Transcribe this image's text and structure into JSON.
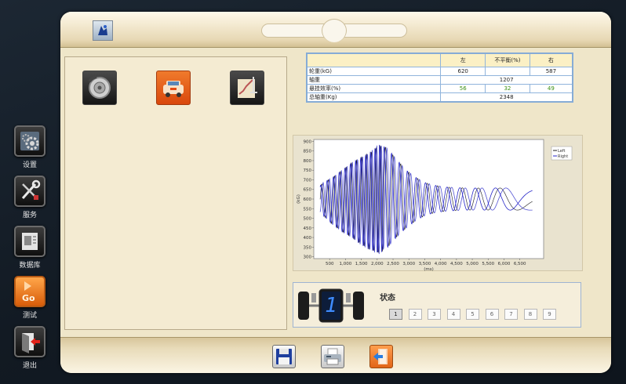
{
  "nav": [
    {
      "key": "settings",
      "label": "设置",
      "icon": "gear-icon"
    },
    {
      "key": "service",
      "label": "服务",
      "icon": "wrench-screwdriver-icon"
    },
    {
      "key": "database",
      "label": "数据库",
      "icon": "database-icon"
    },
    {
      "key": "test",
      "label": "测试",
      "icon": "play-go-icon",
      "badge": "Go",
      "active": true
    },
    {
      "key": "exit",
      "label": "退出",
      "icon": "exit-arrow-icon"
    }
  ],
  "table": {
    "headers": [
      "",
      "左",
      "不平衡(%)",
      "右"
    ],
    "rows": [
      {
        "label": "轮重(kG)",
        "left": "620",
        "mid": "",
        "right": "587"
      },
      {
        "label": "轴重",
        "span": "1207"
      },
      {
        "label": "悬挂效率(%)",
        "left": "56",
        "mid": "32",
        "right": "49",
        "green": true
      },
      {
        "label": "总轴重(Kg)",
        "span": "2348"
      }
    ]
  },
  "chart_data": {
    "type": "line",
    "title": "",
    "xlabel": "(ms)",
    "ylabel": "(kG)",
    "xlim": [
      0,
      7250
    ],
    "ylim": [
      290,
      910
    ],
    "xticks": [
      "500",
      "1,000",
      "1,500",
      "2,000",
      "2,500",
      "3,000",
      "3,500",
      "4,000",
      "4,500",
      "5,000",
      "5,500",
      "6,000",
      "6,500"
    ],
    "yticks": [
      "300",
      "350",
      "400",
      "450",
      "500",
      "550",
      "600",
      "650",
      "700",
      "750",
      "800",
      "850",
      "900"
    ],
    "legend_position": "top-right",
    "series": [
      {
        "name": "Left",
        "color": "#1a1a1a",
        "values": [
          [
            0,
            640
          ],
          [
            300,
            690
          ],
          [
            600,
            720
          ],
          [
            900,
            760
          ],
          [
            1200,
            800
          ],
          [
            1500,
            830
          ],
          [
            1800,
            860
          ],
          [
            2050,
            900
          ],
          [
            2300,
            880
          ],
          [
            2600,
            820
          ],
          [
            2900,
            760
          ],
          [
            3200,
            720
          ],
          [
            3500,
            690
          ],
          [
            3800,
            675
          ],
          [
            4200,
            665
          ],
          [
            4800,
            660
          ],
          [
            5500,
            660
          ],
          [
            6200,
            660
          ],
          [
            6900,
            660
          ]
        ]
      },
      {
        "name": "Right",
        "color": "#2626c8",
        "values": [
          [
            0,
            560
          ],
          [
            300,
            510
          ],
          [
            600,
            460
          ],
          [
            900,
            420
          ],
          [
            1200,
            390
          ],
          [
            1500,
            350
          ],
          [
            1800,
            320
          ],
          [
            2050,
            300
          ],
          [
            2300,
            330
          ],
          [
            2600,
            390
          ],
          [
            2900,
            440
          ],
          [
            3200,
            480
          ],
          [
            3500,
            510
          ],
          [
            3800,
            525
          ],
          [
            4200,
            535
          ],
          [
            4800,
            540
          ],
          [
            5500,
            540
          ],
          [
            6200,
            540
          ],
          [
            6900,
            540
          ]
        ]
      }
    ]
  },
  "status": {
    "label": "状态",
    "digit": "1",
    "steps": [
      "1",
      "2",
      "3",
      "4",
      "5",
      "6",
      "7",
      "8",
      "9"
    ],
    "current": "1"
  },
  "toolbar": {
    "save_icon": "floppy-disk-icon",
    "print_icon": "printer-icon",
    "exit_icon": "exit-door-icon"
  },
  "colors": {
    "accent": "#ef7a18",
    "window": "#efe6c9",
    "table_header": "#fbf0c5",
    "green": "#3a8f12"
  }
}
